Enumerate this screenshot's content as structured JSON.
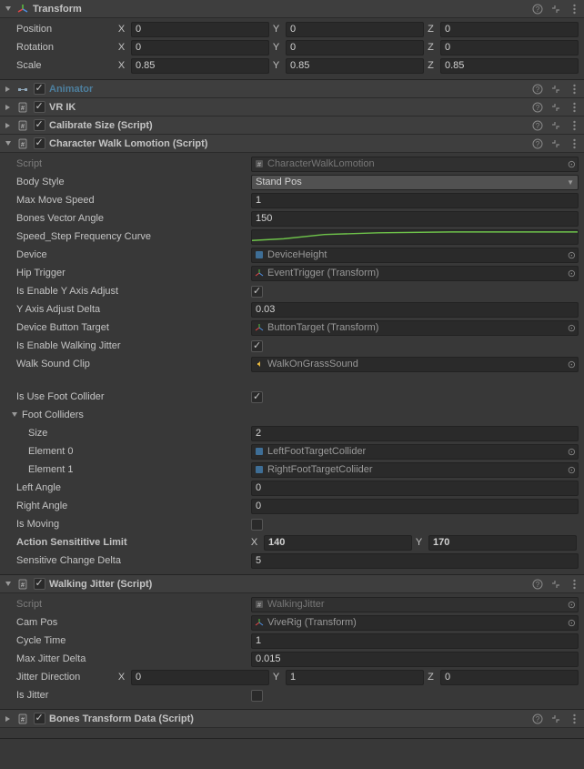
{
  "transform": {
    "title": "Transform",
    "labels": {
      "position": "Position",
      "rotation": "Rotation",
      "scale": "Scale"
    },
    "position": {
      "x": "0",
      "y": "0",
      "z": "0"
    },
    "rotation": {
      "x": "0",
      "y": "0",
      "z": "0"
    },
    "scale": {
      "x": "0.85",
      "y": "0.85",
      "z": "0.85"
    }
  },
  "animator": {
    "title": "Animator"
  },
  "vrik": {
    "title": "VR IK",
    "enabled": true
  },
  "calibrate": {
    "title": "Calibrate Size (Script)",
    "enabled": true
  },
  "walk": {
    "title": "Character Walk Lomotion (Script)",
    "enabled": true,
    "label_script": "Script",
    "script": "CharacterWalkLomotion",
    "label_body_style": "Body Style",
    "body_style": "Stand Pos",
    "label_max_move_speed": "Max Move Speed",
    "max_move_speed": "1",
    "label_bones_vector_angle": "Bones Vector Angle",
    "bones_vector_angle": "150",
    "label_curve": "Speed_Step Frequency Curve",
    "label_device": "Device",
    "device": "DeviceHeight",
    "label_hip_trigger": "Hip Trigger",
    "hip_trigger": "EventTrigger (Transform)",
    "label_enable_y_adjust": "Is Enable Y Axis Adjust",
    "enable_y_adjust": true,
    "label_y_adjust_delta": "Y Axis Adjust Delta",
    "y_adjust_delta": "0.03",
    "label_device_button_target": "Device Button Target",
    "device_button_target": "ButtonTarget (Transform)",
    "label_enable_jitter": "Is Enable Walking Jitter",
    "enable_jitter": true,
    "label_walk_sound": "Walk Sound Clip",
    "walk_sound": "WalkOnGrassSound",
    "label_use_foot_collider": "Is Use Foot Collider",
    "use_foot_collider": true,
    "foot_colliders": {
      "label": "Foot Colliders",
      "label_size": "Size",
      "size": "2",
      "label_e0": "Element 0",
      "e0": "LeftFootTargetCollider",
      "label_e1": "Element 1",
      "e1": "RightFootTargetColiider"
    },
    "label_left_angle": "Left Angle",
    "left_angle": "0",
    "label_right_angle": "Right Angle",
    "right_angle": "0",
    "label_is_moving": "Is Moving",
    "is_moving": false,
    "label_action_sens": "Action Sensititive Limit",
    "action_sens_x": "140",
    "action_sens_y": "170",
    "label_sens_delta": "Sensitive Change Delta",
    "sens_delta": "5"
  },
  "jitter": {
    "title": "Walking Jitter (Script)",
    "enabled": true,
    "label_script": "Script",
    "script": "WalkingJitter",
    "label_cam_pos": "Cam Pos",
    "cam_pos": "ViveRig (Transform)",
    "label_cycle_time": "Cycle Time",
    "cycle_time": "1",
    "label_max_delta": "Max Jitter Delta",
    "max_delta": "0.015",
    "label_dir": "Jitter Direction",
    "dir_x": "0",
    "dir_y": "1",
    "dir_z": "0",
    "label_is_jitter": "Is Jitter",
    "is_jitter": false
  },
  "bones": {
    "title": "Bones Transform Data (Script)",
    "enabled": true
  },
  "axis": {
    "x": "X",
    "y": "Y",
    "z": "Z"
  }
}
